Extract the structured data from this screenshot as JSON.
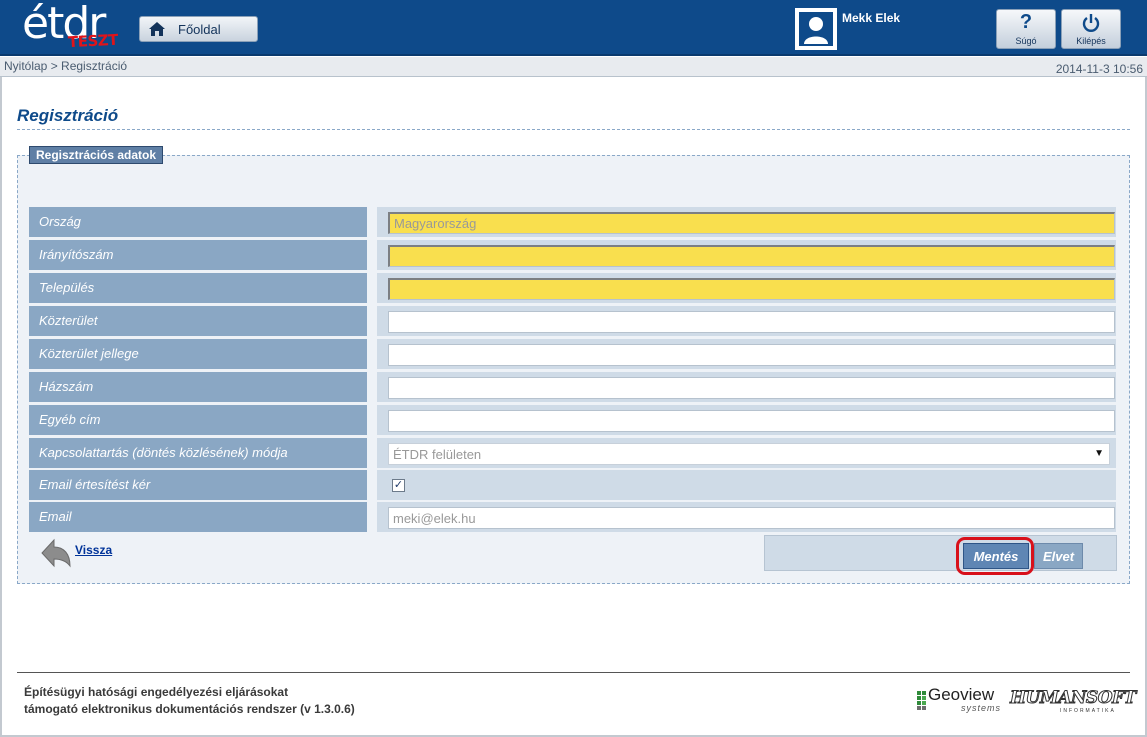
{
  "header": {
    "logo_text": "étdr",
    "logo_badge": "TESZT",
    "home_label": "Főoldal",
    "user_name": "Mekk Elek",
    "help_label": "Súgó",
    "logout_label": "Kilépés",
    "brand_color": "#0e4a8a"
  },
  "breadcrumb": {
    "text": "Nyitólap > Regisztráció",
    "datetime": "2014-11-3 10:56"
  },
  "page": {
    "title": "Regisztráció"
  },
  "form": {
    "legend": "Regisztrációs adatok",
    "fields": [
      {
        "label": "Ország",
        "value": "Magyarország",
        "type": "text",
        "required": true
      },
      {
        "label": "Irányítószám",
        "value": "",
        "type": "text",
        "required": true
      },
      {
        "label": "Település",
        "value": "",
        "type": "text",
        "required": true
      },
      {
        "label": "Közterület",
        "value": "",
        "type": "text",
        "required": false
      },
      {
        "label": "Közterület jellege",
        "value": "",
        "type": "text",
        "required": false
      },
      {
        "label": "Házszám",
        "value": "",
        "type": "text",
        "required": false
      },
      {
        "label": "Egyéb cím",
        "value": "",
        "type": "text",
        "required": false
      },
      {
        "label": "Kapcsolattartás (döntés közlésének) módja",
        "value": "ÉTDR felületen",
        "type": "select",
        "required": false
      },
      {
        "label": "Email értesítést kér",
        "value": "✓",
        "checked": true,
        "type": "checkbox",
        "required": false
      },
      {
        "label": "Email",
        "value": "meki@elek.hu",
        "type": "text",
        "required": false
      }
    ],
    "required_color": "#f9df4e"
  },
  "actions": {
    "back_label": "Vissza",
    "save_label": "Mentés",
    "reject_label": "Elvet",
    "highlight_color": "#d8101a"
  },
  "footer": {
    "line1": "Építésügyi hatósági engedélyezési eljárásokat",
    "line2": "támogató elektronikus dokumentációs rendszer (v 1.3.0.6)",
    "geoview_name": "Geoview",
    "geoview_sub": "systems",
    "humansoft_name": "HUMANSOFT",
    "humansoft_sub": "INFORMATIKA"
  }
}
